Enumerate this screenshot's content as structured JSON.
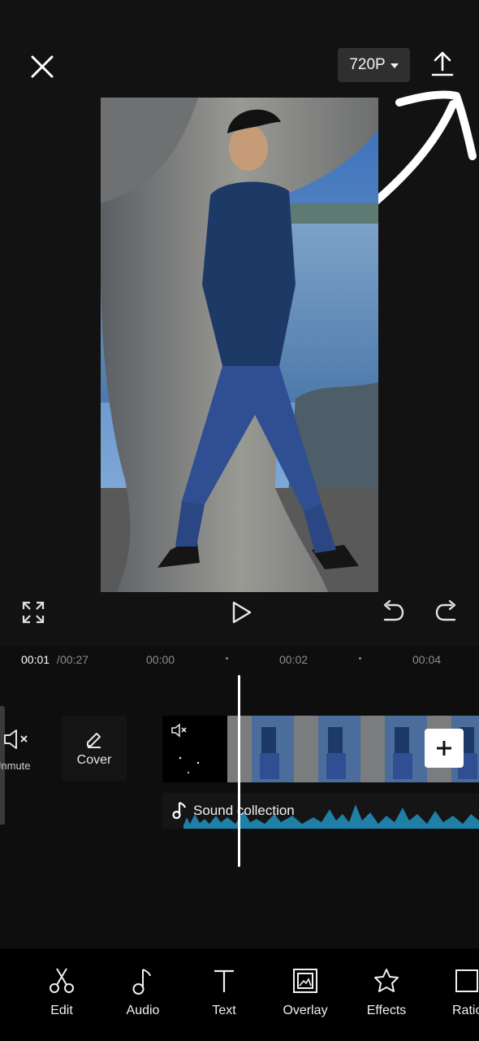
{
  "header": {
    "resolution": "720P"
  },
  "timeline": {
    "current_time": "00:01",
    "separator": " / ",
    "total_time": "00:27",
    "ruler": [
      "00:00",
      "00:02",
      "00:04"
    ]
  },
  "tracks": {
    "unmute_label": "Unmute",
    "cover_label": "Cover",
    "audio_label": "Sound collection"
  },
  "toolbar": {
    "items": [
      {
        "label": "Edit",
        "icon": "scissors-icon"
      },
      {
        "label": "Audio",
        "icon": "music-note-icon"
      },
      {
        "label": "Text",
        "icon": "text-icon"
      },
      {
        "label": "Overlay",
        "icon": "overlay-icon"
      },
      {
        "label": "Effects",
        "icon": "star-icon"
      },
      {
        "label": "Ratio",
        "icon": "ratio-icon"
      }
    ]
  },
  "colors": {
    "background": "#121212",
    "toolbar": "#000000",
    "resolution_button": "#2f2f2f",
    "waveform": "#1f7fa6"
  }
}
